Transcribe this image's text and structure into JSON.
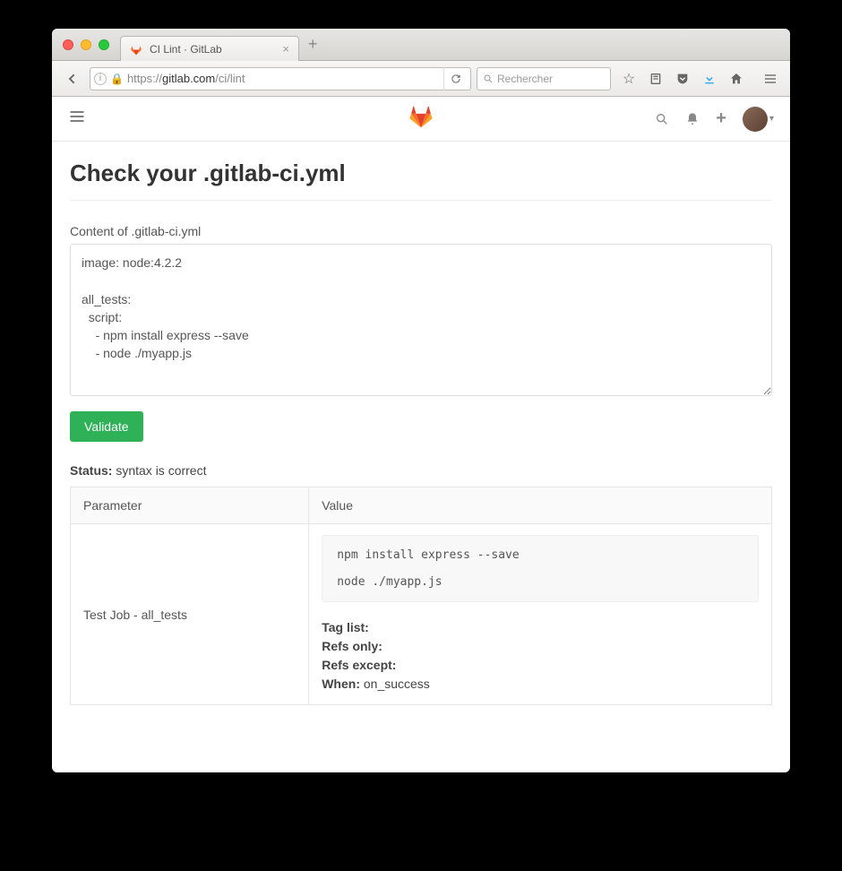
{
  "browser": {
    "tab_title": "CI Lint · GitLab",
    "url_protocol": "https://",
    "url_host": "gitlab.com",
    "url_path": "/ci/lint",
    "search_placeholder": "Rechercher"
  },
  "page": {
    "title": "Check your .gitlab-ci.yml",
    "content_label": "Content of .gitlab-ci.yml",
    "textarea_value": "image: node:4.2.2\n\nall_tests:\n  script:\n    - npm install express --save\n    - node ./myapp.js",
    "validate_label": "Validate",
    "status_label": "Status:",
    "status_value": "syntax is correct"
  },
  "table": {
    "header_param": "Parameter",
    "header_value": "Value",
    "row": {
      "param": "Test Job - all_tests",
      "script": "npm install express --save\n\nnode ./myapp.js",
      "tag_list_label": "Tag list:",
      "tag_list_value": "",
      "refs_only_label": "Refs only:",
      "refs_only_value": "",
      "refs_except_label": "Refs except:",
      "refs_except_value": "",
      "when_label": "When:",
      "when_value": "on_success"
    }
  }
}
